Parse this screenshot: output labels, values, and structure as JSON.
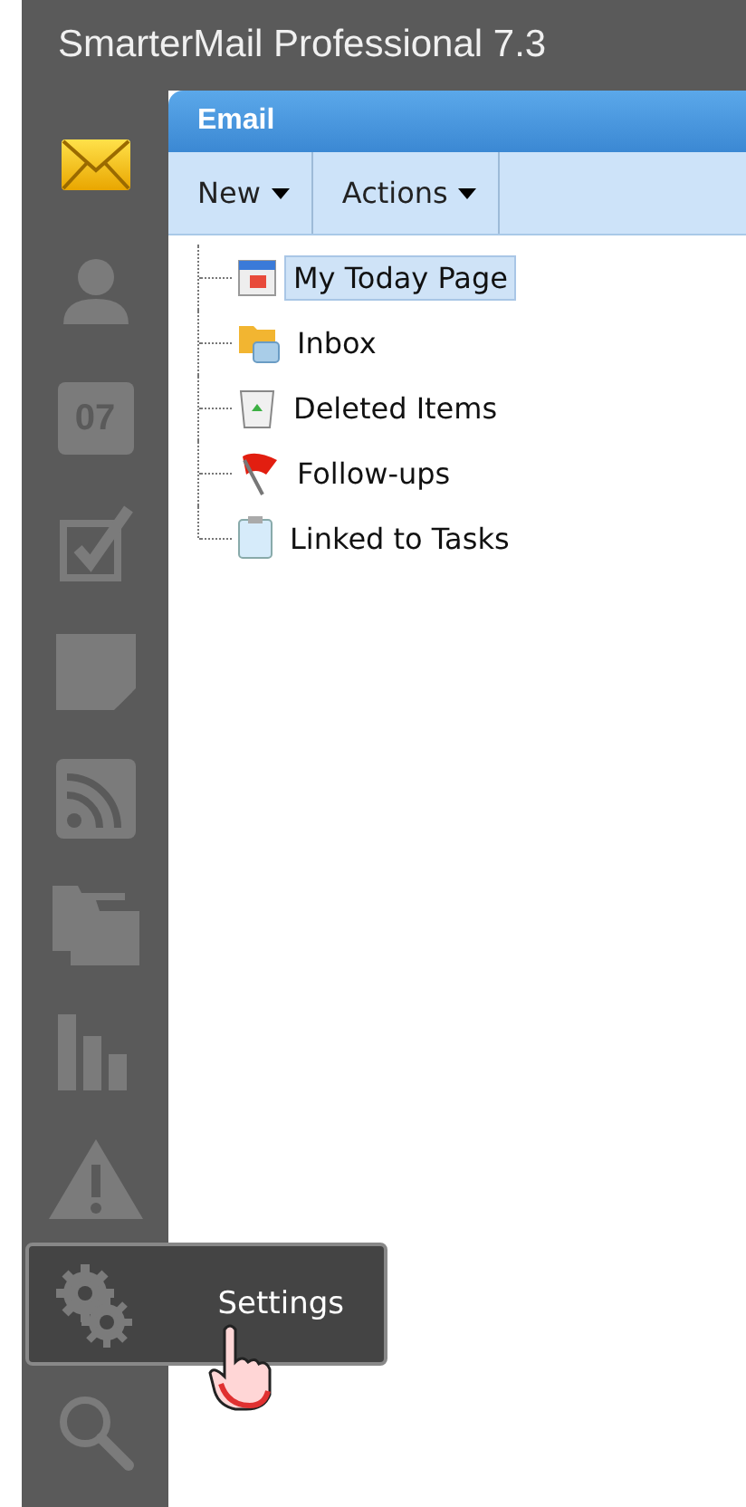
{
  "window": {
    "title": "SmarterMail Professional 7.3"
  },
  "sidebar": {
    "items": [
      {
        "kind": "mail",
        "selected": true
      },
      {
        "kind": "contacts",
        "selected": false
      },
      {
        "kind": "calendar",
        "selected": false,
        "icon_text": "07"
      },
      {
        "kind": "tasks",
        "selected": false
      },
      {
        "kind": "notes",
        "selected": false
      },
      {
        "kind": "rss",
        "selected": false
      },
      {
        "kind": "files",
        "selected": false
      },
      {
        "kind": "reports",
        "selected": false
      },
      {
        "kind": "alerts",
        "selected": false
      },
      {
        "kind": "settings",
        "selected": false,
        "tooltip": "Settings"
      },
      {
        "kind": "search",
        "selected": false
      }
    ]
  },
  "panel": {
    "title": "Email",
    "toolbar": [
      {
        "label": "New"
      },
      {
        "label": "Actions"
      }
    ],
    "tree": [
      {
        "kind": "today",
        "label": "My Today Page",
        "selected": true
      },
      {
        "kind": "inbox",
        "label": "Inbox",
        "selected": false
      },
      {
        "kind": "deleted",
        "label": "Deleted Items",
        "selected": false
      },
      {
        "kind": "followups",
        "label": "Follow-ups",
        "selected": false
      },
      {
        "kind": "tasks",
        "label": "Linked to Tasks",
        "selected": false
      }
    ]
  }
}
